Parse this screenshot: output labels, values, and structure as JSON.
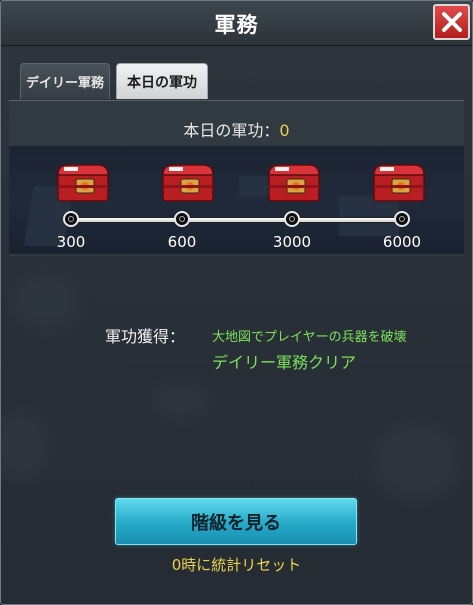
{
  "window": {
    "title": "軍務"
  },
  "tabs": [
    {
      "label": "デイリー軍務",
      "active": false
    },
    {
      "label": "本日の軍功",
      "active": true
    }
  ],
  "today": {
    "label": "本日の軍功：",
    "value": "0"
  },
  "milestones": [
    {
      "label": "300",
      "icon": "reward-chest-icon"
    },
    {
      "label": "600",
      "icon": "reward-chest-icon"
    },
    {
      "label": "3000",
      "icon": "reward-chest-icon"
    },
    {
      "label": "6000",
      "icon": "reward-chest-icon"
    }
  ],
  "acquire": {
    "label": "軍功獲得：",
    "method_1": "大地図でプレイヤーの兵器を破壊",
    "method_2": "デイリー軍務クリア"
  },
  "rank_button": {
    "label": "階級を見る"
  },
  "reset_note": "0時に統計リセット",
  "colors": {
    "accent_green": "#7ae35a",
    "accent_yellow": "#ecd24a",
    "button_cyan": "#25a9c8",
    "close_red": "#c22a2a"
  }
}
